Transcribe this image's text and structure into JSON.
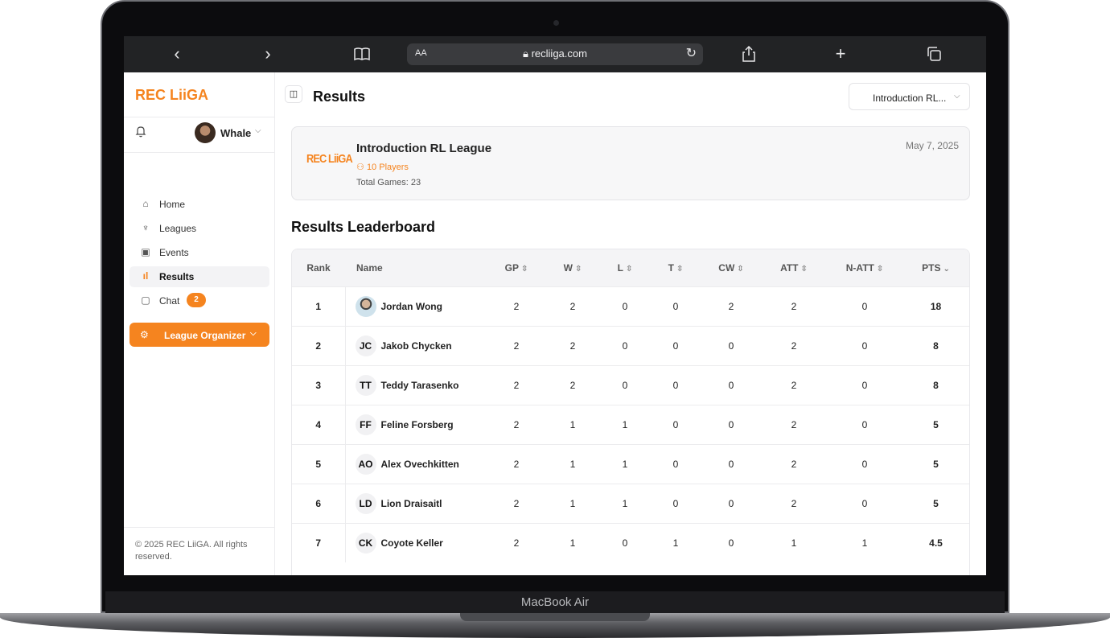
{
  "device_label": "MacBook Air",
  "browser": {
    "back": "‹",
    "forward": "›",
    "text_size": "AA",
    "url": "recliiga.com"
  },
  "sidebar": {
    "brand": "REC LiiGA",
    "user_name": "Whale",
    "nav": [
      {
        "label": "Home",
        "icon": "home-icon"
      },
      {
        "label": "Leagues",
        "icon": "trophy-icon"
      },
      {
        "label": "Events",
        "icon": "calendar-icon"
      },
      {
        "label": "Results",
        "icon": "bar-chart-icon",
        "active": true
      },
      {
        "label": "Chat",
        "icon": "chat-icon",
        "badge": "2"
      }
    ],
    "organizer_label": "League Organizer",
    "footer": "© 2025 REC LiiGA. All rights reserved."
  },
  "header": {
    "title": "Results",
    "league_select": "Introduction RL..."
  },
  "league_card": {
    "logo_text": "REC LiiGA",
    "title": "Introduction RL League",
    "players": "10 Players",
    "total_games": "Total Games: 23",
    "date": "May 7, 2025"
  },
  "leaderboard": {
    "title": "Results Leaderboard",
    "columns": [
      "Rank",
      "Name",
      "GP",
      "W",
      "L",
      "T",
      "CW",
      "ATT",
      "N-ATT",
      "PTS"
    ],
    "rows": [
      {
        "rank": "1",
        "initials": "",
        "photo": true,
        "name": "Jordan Wong",
        "gp": "2",
        "w": "2",
        "l": "0",
        "t": "0",
        "cw": "2",
        "att": "2",
        "natt": "0",
        "pts": "18"
      },
      {
        "rank": "2",
        "initials": "JC",
        "name": "Jakob Chycken",
        "gp": "2",
        "w": "2",
        "l": "0",
        "t": "0",
        "cw": "0",
        "att": "2",
        "natt": "0",
        "pts": "8"
      },
      {
        "rank": "3",
        "initials": "TT",
        "name": "Teddy Tarasenko",
        "gp": "2",
        "w": "2",
        "l": "0",
        "t": "0",
        "cw": "0",
        "att": "2",
        "natt": "0",
        "pts": "8"
      },
      {
        "rank": "4",
        "initials": "FF",
        "name": "Feline Forsberg",
        "gp": "2",
        "w": "1",
        "l": "1",
        "t": "0",
        "cw": "0",
        "att": "2",
        "natt": "0",
        "pts": "5"
      },
      {
        "rank": "5",
        "initials": "AO",
        "name": "Alex Ovechkitten",
        "gp": "2",
        "w": "1",
        "l": "1",
        "t": "0",
        "cw": "0",
        "att": "2",
        "natt": "0",
        "pts": "5"
      },
      {
        "rank": "6",
        "initials": "LD",
        "name": "Lion Draisaitl",
        "gp": "2",
        "w": "1",
        "l": "1",
        "t": "0",
        "cw": "0",
        "att": "2",
        "natt": "0",
        "pts": "5"
      },
      {
        "rank": "7",
        "initials": "CK",
        "name": "Coyote Keller",
        "gp": "2",
        "w": "1",
        "l": "0",
        "t": "1",
        "cw": "0",
        "att": "1",
        "natt": "1",
        "pts": "4.5"
      }
    ]
  },
  "colors": {
    "accent": "#f5841f",
    "toolbar": "#222325"
  }
}
